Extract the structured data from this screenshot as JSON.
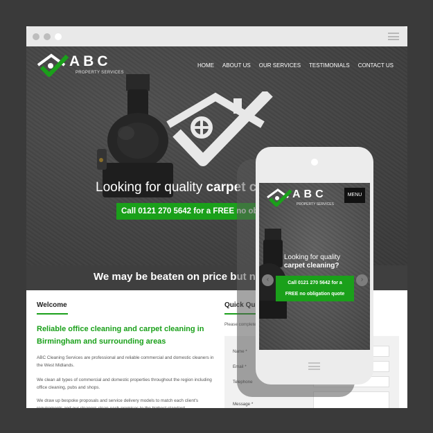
{
  "site": {
    "logo_text": "ABC",
    "logo_sub": "PROPERTY SERVICES"
  },
  "nav": {
    "items": [
      "HOME",
      "ABOUT US",
      "OUR SERVICES",
      "TESTIMONIALS",
      "CONTACT US"
    ]
  },
  "hero": {
    "heading_regular": "Looking for quality ",
    "heading_bold": "carpet cleaning?",
    "cta": "Call 0121 270 5642 for a FREE no obligation quote"
  },
  "price_band": "We may be beaten on price but never on quality",
  "welcome": {
    "title": "Welcome",
    "tagline": "Reliable office cleaning and carpet cleaning in Birmingham and surrounding areas",
    "para1": "ABC Cleaning Services are professional and reliable commercial and domestic cleaners in the West Midlands.",
    "para2": "We clean all types of commercial and domestic properties throughout the region including office cleaning, pubs and shops.",
    "para3": "We draw up bespoke proposals and service delivery models to match each client's requirements and our cleaners clean each premises to the highest standard."
  },
  "quick": {
    "title": "Quick Quote",
    "intro": "Please complete the form below",
    "fields": {
      "name": "Name *",
      "email": "Email *",
      "telephone": "Telephone",
      "message": "Message *"
    }
  },
  "mobile": {
    "menu": "MENU",
    "heading_line1": "Looking for quality",
    "heading_line2": "carpet cleaning?",
    "cta_line1": "Call 0121 270 5642 for a",
    "cta_line2": "FREE no obligation quote",
    "prev": "‹",
    "next": "›"
  },
  "colors": {
    "brand_green": "#1aa01a",
    "background": "#3a3a3a"
  },
  "icons": [
    "house-check-logo-icon",
    "vacuum-image",
    "hamburger-icon",
    "chevron-left-icon",
    "chevron-right-icon"
  ]
}
